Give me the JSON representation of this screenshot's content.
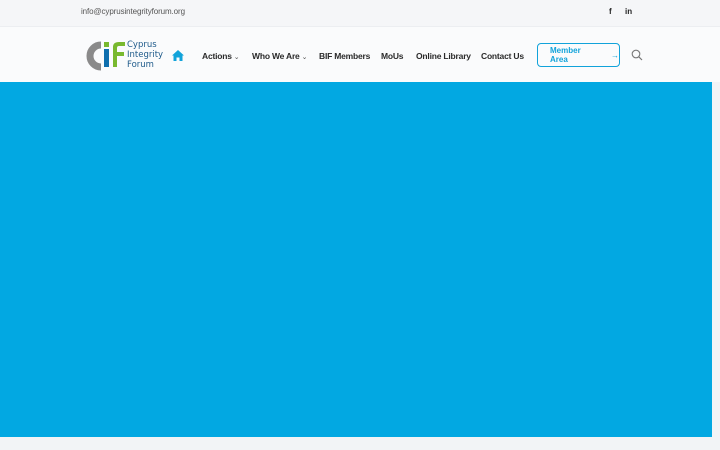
{
  "topbar": {
    "email": "info@cyprusintegrityforum.org",
    "social": [
      "f",
      "in"
    ]
  },
  "logo": {
    "line1": "Cyprus",
    "line2": "Integrity",
    "line3": "Forum"
  },
  "nav": {
    "items": [
      {
        "label": "Actions",
        "has_dropdown": true
      },
      {
        "label": "Who We Are",
        "has_dropdown": true
      },
      {
        "label": "BIF Members",
        "has_dropdown": false
      },
      {
        "label": "MoUs",
        "has_dropdown": false
      },
      {
        "label": "Online Library",
        "has_dropdown": false
      },
      {
        "label": "Contact Us",
        "has_dropdown": false
      }
    ],
    "chevron": "⌄"
  },
  "member_button": {
    "label": "Member Area",
    "arrow": "→"
  },
  "colors": {
    "accent": "#02a8e2",
    "logo_gray": "#8a8a8a",
    "logo_green": "#79b92f",
    "logo_blue": "#0f6fae"
  },
  "icons": {
    "home": "home-icon",
    "search": "search-icon",
    "facebook": "facebook-icon",
    "linkedin": "linkedin-icon"
  }
}
